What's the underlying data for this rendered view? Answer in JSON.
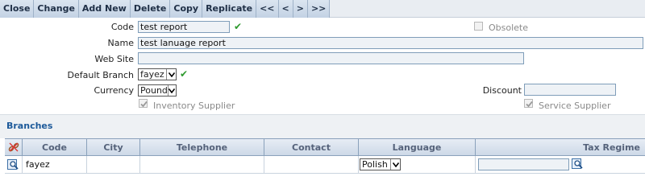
{
  "toolbar": {
    "buttons": [
      "Close",
      "Change",
      "Add New",
      "Delete",
      "Copy",
      "Replicate",
      "<<",
      "<",
      ">",
      ">>"
    ]
  },
  "form": {
    "code": {
      "label": "Code",
      "value": "test report"
    },
    "name": {
      "label": "Name",
      "value": "test lanuage report"
    },
    "website": {
      "label": "Web Site",
      "value": ""
    },
    "default_branch": {
      "label": "Default Branch",
      "value": "fayez"
    },
    "currency": {
      "label": "Currency",
      "value": "Pound"
    },
    "discount": {
      "label": "Discount",
      "value": ""
    },
    "obsolete": {
      "label": "Obsolete",
      "checked": false
    },
    "inventory_supplier": {
      "label": "Inventory Supplier",
      "checked": true
    },
    "service_supplier": {
      "label": "Service Supplier",
      "checked": true
    }
  },
  "branches": {
    "title": "Branches",
    "columns": [
      "Code",
      "City",
      "Telephone",
      "Contact",
      "Language",
      "Tax Regime"
    ],
    "rows": [
      {
        "code": "fayez",
        "city": "",
        "telephone": "",
        "contact": "",
        "language": "Polish",
        "tax_regime": ""
      }
    ]
  },
  "icons": {
    "validation": "check-icon",
    "grid_header": "delete-links-icon",
    "row_open": "magnifier-icon",
    "tax_lookup": "magnifier-icon"
  },
  "colors": {
    "toolbar_bg": "#c3d2e4",
    "section_title": "#1d5a9a",
    "check": "#2e9a2e",
    "grid_header_text": "#55627a"
  }
}
